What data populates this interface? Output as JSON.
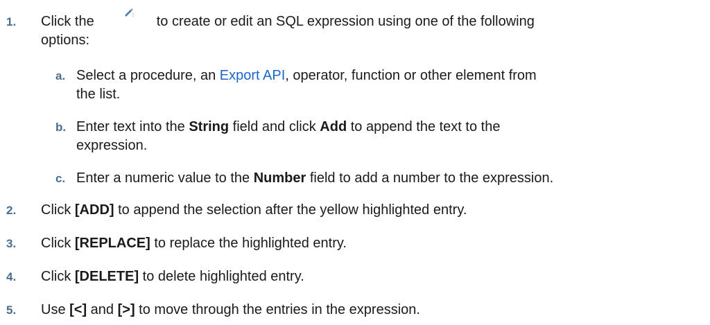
{
  "steps": [
    {
      "num": "1.",
      "pre": "Click the",
      "post": "to create or edit an SQL expression using one of the following",
      "line2": "options:",
      "icon": "pencil-edit-icon"
    },
    {
      "num": "2.",
      "pre": "Click ",
      "bold": "[ADD]",
      "post": " to append the selection after the yellow highlighted entry."
    },
    {
      "num": "3.",
      "pre": "Click ",
      "bold": "[REPLACE]",
      "post": " to replace the highlighted entry."
    },
    {
      "num": "4.",
      "pre": "Click ",
      "bold": "[DELETE]",
      "post": " to delete highlighted entry."
    },
    {
      "num": "5.",
      "pre": "Use ",
      "bold1": "[<]",
      "mid": " and ",
      "bold2": "[>]",
      "post": " to move through the entries in the expression."
    }
  ],
  "substeps": [
    {
      "num": "a.",
      "pre": "Select a procedure, an ",
      "link": "Export API",
      "post": ", operator, function or other element from",
      "line2": "the list."
    },
    {
      "num": "b.",
      "pre": "Enter text into the ",
      "bold1": "String",
      "mid": " field and click ",
      "bold2": "Add",
      "post": " to append the text to the",
      "line2": "expression."
    },
    {
      "num": "c.",
      "pre": "Enter a numeric value to the ",
      "bold": "Number",
      "post": " field to add a number to the expression."
    }
  ],
  "colors": {
    "number": "#4a6d8c",
    "link": "#1a66cc",
    "text": "#1a1a1a"
  }
}
